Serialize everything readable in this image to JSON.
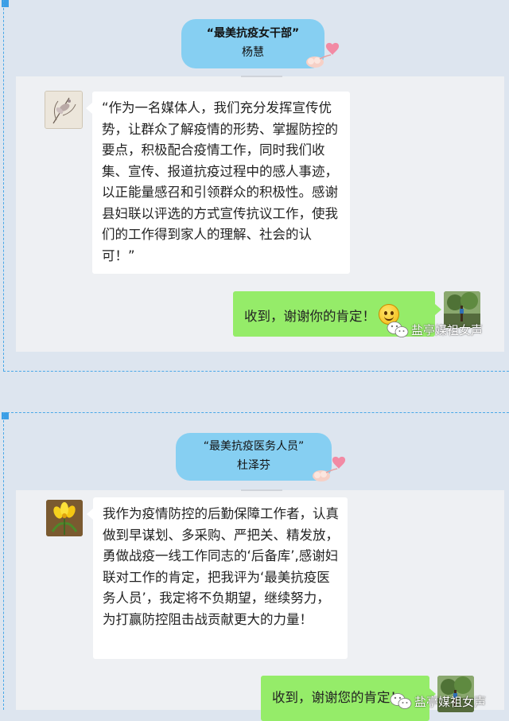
{
  "colors": {
    "page_bg": "#dde5ef",
    "panel_bg": "#eef0f3",
    "title_pill": "#86cff2",
    "dash_border": "#4aa8e8",
    "received_bubble": "#ffffff",
    "sent_bubble": "#95ec69"
  },
  "watermark": {
    "text": "盐亭媒祖女声",
    "icon": "wechat-icon"
  },
  "section1": {
    "award_title": "“最美抗疫女干部”",
    "person_name": "杨慧",
    "avatar_icon": "flower-sketch-avatar",
    "message": "“作为一名媒体人，我们充分发挥宣传优势，让群众了解疫情的形势、掌握防控的要点，积极配合疫情工作，同时我们收集、宣传、报道抗疫过程中的感人事迹，以正能量感召和引领群众的积极性。感谢县妇联以评选的方式宣传抗议工作，使我们的工作得到家人的理解、社会的认可！”",
    "reply": "收到，谢谢你的肯定！",
    "reply_icon": "smiley-emoji",
    "reply_avatar_icon": "tree-avatar"
  },
  "section2": {
    "award_title": "“最美抗疫医务人员”",
    "person_name": "杜泽芬",
    "avatar_icon": "yellow-flower-avatar",
    "message": "我作为疫情防控的后勤保障工作者，认真做到早谋划、多采购、严把关、精发放，勇做战疫一线工作同志的‘后备库’,感谢妇联对工作的肯定，把我评为‘最美抗疫医务人员’，我定将不负期望，继续努力，为打赢防控阻击战贡献更大的力量！",
    "reply": "收到，谢谢您的肯定！",
    "reply_avatar_icon": "tree-avatar"
  }
}
